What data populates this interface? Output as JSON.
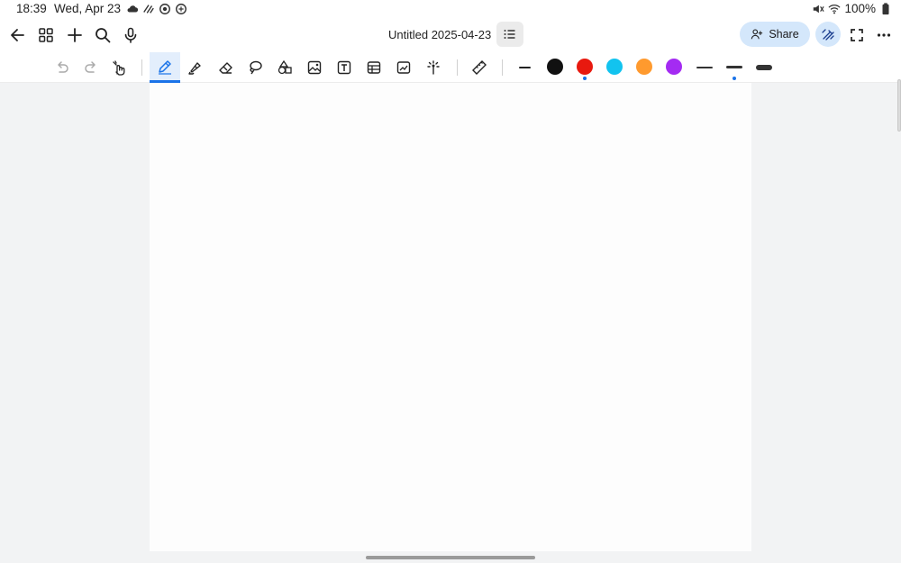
{
  "statusbar": {
    "time": "18:39",
    "date": "Wed, Apr 23",
    "battery": "100%",
    "icons": [
      "cloud-icon",
      "wind-icon",
      "sync-icon",
      "vpn-icon"
    ],
    "right_icons": [
      "mute-icon",
      "wifi-icon",
      "battery-icon"
    ]
  },
  "header": {
    "title": "Untitled 2025-04-23",
    "share_label": "Share",
    "buttons": [
      "back-icon",
      "grid-icon",
      "add-icon",
      "search-icon",
      "mic-icon",
      "outline-icon",
      "ai-pen-icon",
      "fullscreen-icon",
      "more-icon"
    ]
  },
  "toolbar": {
    "tools": [
      "undo",
      "redo",
      "touch-draw",
      "pen",
      "highlighter",
      "eraser",
      "lasso",
      "shapes",
      "image",
      "text",
      "table",
      "chart",
      "laser",
      "ruler"
    ],
    "active_tool": "pen",
    "colors": [
      "#111111",
      "#e8190f",
      "#12c3ef",
      "#ff9a2e",
      "#a42bf2"
    ],
    "selected_color": "#e8190f",
    "thicknesses": [
      "thin",
      "medium",
      "thick"
    ],
    "selected_thickness": "medium"
  },
  "accent": "#1a73e8"
}
